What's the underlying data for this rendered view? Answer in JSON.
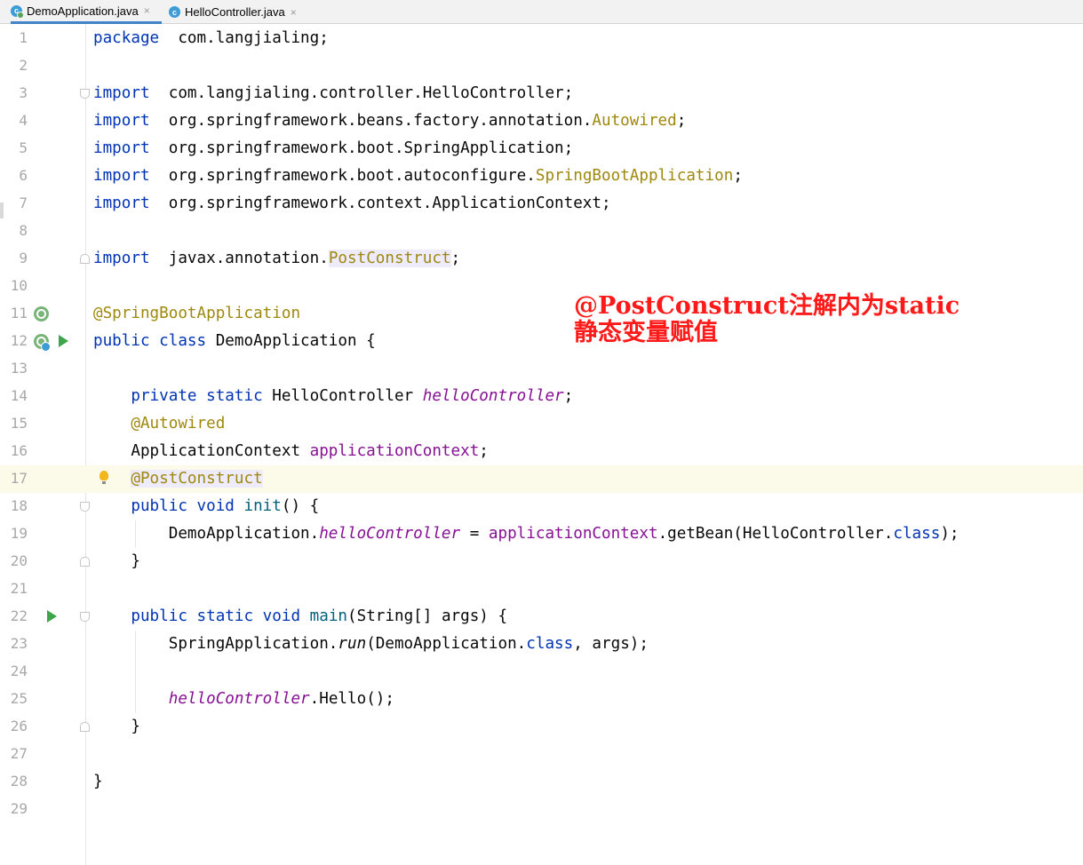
{
  "tabs": [
    {
      "label": "DemoApplication.java",
      "icon": "java-class-icon",
      "active": true
    },
    {
      "label": "HelloController.java",
      "icon": "java-class-icon",
      "active": false
    }
  ],
  "tab_close_glyph": "×",
  "colors": {
    "keyword": "#0033b3",
    "annotation": "#9e880d",
    "field": "#871094",
    "method": "#00627a",
    "text": "#080808",
    "line_number": "#a8a8a8",
    "current_line": "#fcfae9",
    "note": "#ff1a1a",
    "run": "#3ea54b"
  },
  "editor": {
    "current_line": 17,
    "line_numbers": [
      "1",
      "2",
      "3",
      "4",
      "5",
      "6",
      "7",
      "8",
      "9",
      "10",
      "11",
      "12",
      "13",
      "14",
      "15",
      "16",
      "17",
      "18",
      "19",
      "20",
      "21",
      "22",
      "23",
      "24",
      "25",
      "26",
      "27",
      "28",
      "29"
    ],
    "lines": [
      [
        [
          "kw",
          "package"
        ],
        [
          "",
          "  com.langjialing;"
        ]
      ],
      [],
      [
        [
          "kw",
          "import"
        ],
        [
          "",
          "  com.langjialing.controller.HelloController;"
        ]
      ],
      [
        [
          "kw",
          "import"
        ],
        [
          "",
          "  org.springframework.beans.factory.annotation."
        ],
        [
          "ann",
          "Autowired"
        ],
        [
          "",
          ";"
        ]
      ],
      [
        [
          "kw",
          "import"
        ],
        [
          "",
          "  org.springframework.boot.SpringApplication;"
        ]
      ],
      [
        [
          "kw",
          "import"
        ],
        [
          "",
          "  org.springframework.boot.autoconfigure."
        ],
        [
          "ann",
          "SpringBootApplication"
        ],
        [
          "",
          ";"
        ]
      ],
      [
        [
          "kw",
          "import"
        ],
        [
          "",
          "  org.springframework.context.ApplicationContext;"
        ]
      ],
      [],
      [
        [
          "kw",
          "import"
        ],
        [
          "",
          "  javax.annotation."
        ],
        [
          "ann hl",
          "PostConstruct"
        ],
        [
          "",
          ";"
        ]
      ],
      [],
      [
        [
          "ann",
          "@SpringBootApplication"
        ]
      ],
      [
        [
          "kw",
          "public class"
        ],
        [
          "",
          " DemoApplication {"
        ]
      ],
      [],
      [
        [
          "",
          "    "
        ],
        [
          "kw",
          "private static"
        ],
        [
          "",
          " HelloController "
        ],
        [
          "fld it",
          "helloController"
        ],
        [
          "",
          ";"
        ]
      ],
      [
        [
          "",
          "    "
        ],
        [
          "ann",
          "@Autowired"
        ]
      ],
      [
        [
          "",
          "    ApplicationContext "
        ],
        [
          "fld",
          "applicationContext"
        ],
        [
          "",
          ";"
        ]
      ],
      [
        [
          "",
          "    "
        ],
        [
          "ann hl",
          "@PostConstruct"
        ]
      ],
      [
        [
          "",
          "    "
        ],
        [
          "kw",
          "public void"
        ],
        [
          "",
          " "
        ],
        [
          "mth",
          "init"
        ],
        [
          "",
          "() {"
        ]
      ],
      [
        [
          "",
          "        DemoApplication."
        ],
        [
          "fld it",
          "helloController"
        ],
        [
          "",
          " = "
        ],
        [
          "fld",
          "applicationContext"
        ],
        [
          "",
          ".getBean(HelloController."
        ],
        [
          "kw",
          "class"
        ],
        [
          "",
          ");"
        ]
      ],
      [
        [
          "",
          "    }"
        ]
      ],
      [],
      [
        [
          "",
          "    "
        ],
        [
          "kw",
          "public static void"
        ],
        [
          "",
          " "
        ],
        [
          "mth",
          "main"
        ],
        [
          "",
          "(String[] args) {"
        ]
      ],
      [
        [
          "",
          "        SpringApplication."
        ],
        [
          "it",
          "run"
        ],
        [
          "",
          "(DemoApplication."
        ],
        [
          "kw",
          "class"
        ],
        [
          "",
          ", args);"
        ]
      ],
      [],
      [
        [
          "",
          "        "
        ],
        [
          "fld it",
          "helloController"
        ],
        [
          "",
          ".Hello();"
        ]
      ],
      [
        [
          "",
          "    }"
        ]
      ],
      [],
      [
        [
          "",
          "}"
        ]
      ],
      []
    ]
  },
  "gutter_icons": {
    "run_lines": [
      12,
      22
    ],
    "bean_lines": [
      11,
      12
    ],
    "bulb_line": 17,
    "fold_open_lines": [
      3,
      18,
      22
    ],
    "fold_close_lines": [
      9,
      20,
      26
    ]
  },
  "annotation_note": {
    "line1": "@PostConstruct注解内为static",
    "line2": "静态变量赋值"
  }
}
